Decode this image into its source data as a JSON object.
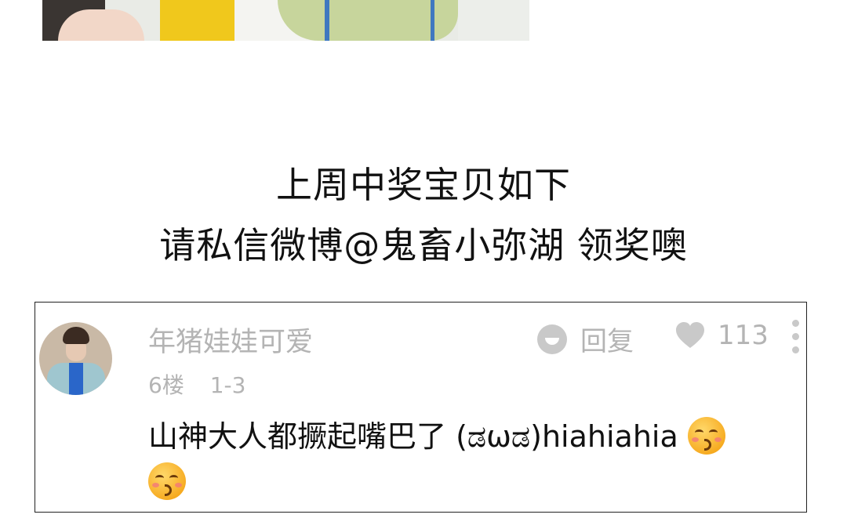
{
  "announcement": {
    "line1": "上周中奖宝贝如下",
    "line2": "请私信微博@鬼畜小弥湖 领奖噢"
  },
  "comment": {
    "username": "年猪娃娃可爱",
    "floor": "6楼",
    "date": "1-3",
    "reply_label": "回复",
    "like_count": "113",
    "text": "山神大人都撅起嘴巴了 (ಡωಡ)hiahiahia ",
    "emoji_icons": [
      "kissing-face-with-closed-eyes-emoji",
      "kissing-face-with-closed-eyes-emoji"
    ]
  },
  "colors": {
    "meta_gray": "#b4b4b4",
    "icon_gray": "#c9c9c9",
    "text": "#111111",
    "card_border": "#222222"
  }
}
